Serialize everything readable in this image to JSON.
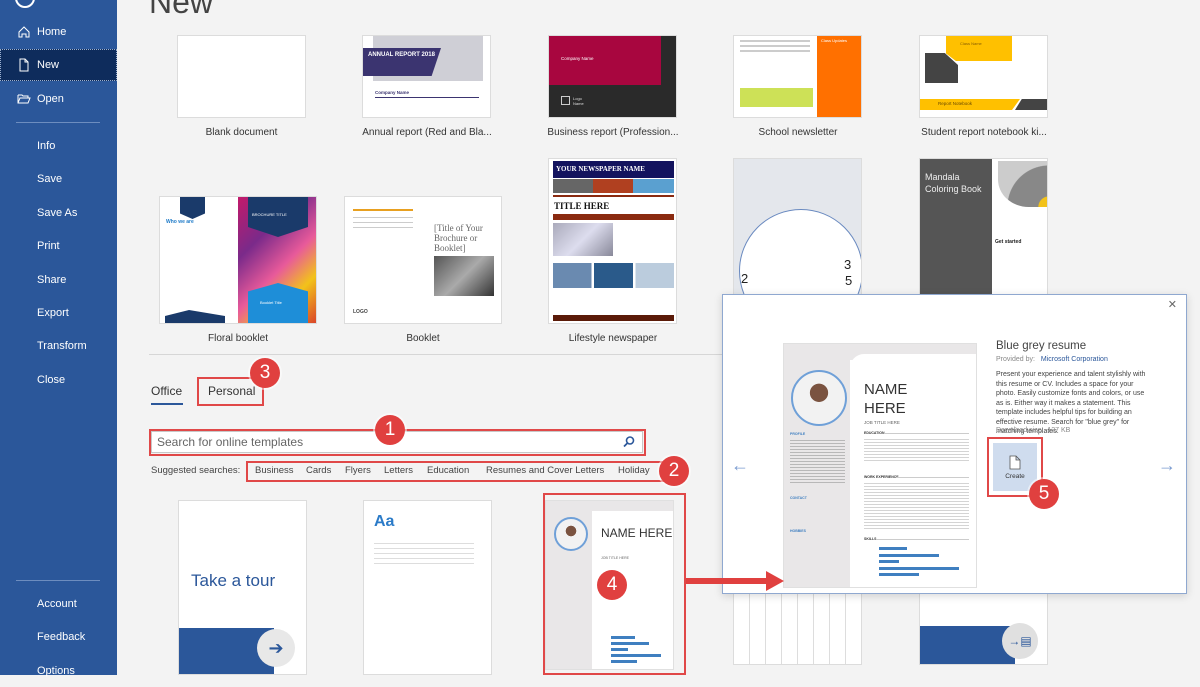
{
  "sidebar": {
    "items": [
      {
        "label": "Home",
        "icon": "home-icon"
      },
      {
        "label": "New",
        "icon": "new-document-icon",
        "active": true
      },
      {
        "label": "Open",
        "icon": "folder-open-icon"
      },
      {
        "label": "Info"
      },
      {
        "label": "Save"
      },
      {
        "label": "Save As"
      },
      {
        "label": "Print"
      },
      {
        "label": "Share"
      },
      {
        "label": "Export"
      },
      {
        "label": "Transform"
      },
      {
        "label": "Close"
      }
    ],
    "bottom_items": [
      {
        "label": "Account"
      },
      {
        "label": "Feedback"
      },
      {
        "label": "Options"
      }
    ]
  },
  "page_title": "New",
  "featured_templates": [
    {
      "label": "Blank document"
    },
    {
      "label": "Annual report (Red and Bla...",
      "thumb_text": "ANNUAL REPORT 2018",
      "sub": "Company Name"
    },
    {
      "label": "Business report (Profession...",
      "thumb_text": "Company Name",
      "sub": "Logo Name"
    },
    {
      "label": "School newsletter",
      "thumb_text": "Class Updates"
    },
    {
      "label": "Student report notebook ki...",
      "thumb_text": "Report Notebook",
      "sub": "Class Name"
    },
    {
      "label": "Floral booklet",
      "thumb_text": "BROCHURE TITLE",
      "sub": "Who we are",
      "sub2": "Booklet Title"
    },
    {
      "label": "Booklet",
      "thumb_text": "[Title of Your Brochure or Booklet]",
      "sub": "LOGO"
    },
    {
      "label": "Lifestyle newspaper",
      "thumb_text": "YOUR NEWSPAPER NAME",
      "sub": "TITLE HERE"
    },
    {
      "label": "",
      "thumb_text": "2 3 5"
    },
    {
      "label": "",
      "thumb_text": "Mandala Coloring Book",
      "sub": "Get started"
    }
  ],
  "tabs": [
    {
      "label": "Office",
      "active": true
    },
    {
      "label": "Personal",
      "active": false
    }
  ],
  "search": {
    "placeholder": "Search for online templates",
    "value": ""
  },
  "suggested": {
    "label": "Suggested searches:",
    "items": [
      "Business",
      "Cards",
      "Flyers",
      "Letters",
      "Education",
      "Resumes and Cover Letters",
      "Holiday"
    ]
  },
  "online_templates": [
    {
      "thumb_text": "Take a tour"
    },
    {
      "thumb_text": "Aa"
    },
    {
      "thumb_text": "NAME HERE",
      "sub": "JOB TITLE HERE"
    }
  ],
  "annotations": [
    "1",
    "2",
    "3",
    "4",
    "5"
  ],
  "dialog": {
    "title": "Blue grey resume",
    "provided_by_label": "Provided by:",
    "provider": "Microsoft Corporation",
    "description": "Present your experience and talent stylishly with this resume or CV. Includes a space for your photo. Easily customize fonts and colors, or use as is. Either way it makes a statement. This template includes helpful tips for building an effective resume. Search for \"blue grey\" for matching templates.",
    "download_size_label": "Download size:",
    "download_size": "127 KB",
    "create_label": "Create",
    "close_glyph": "✕",
    "prev_glyph": "←",
    "next_glyph": "→",
    "preview": {
      "name_line1": "NAME",
      "name_line2": "HERE",
      "job_title": "JOB TITLE HERE",
      "sections": [
        "EDUCATION",
        "WORK EXPERIENCE",
        "SKILLS"
      ],
      "left_sections": [
        "PROFILE",
        "CONTACT",
        "HOBBIES"
      ],
      "skill_levels": [
        0.35,
        0.75,
        0.25,
        1.0,
        0.5
      ]
    }
  },
  "colors": {
    "accent": "#2b579a",
    "annotation": "#e0403f"
  }
}
